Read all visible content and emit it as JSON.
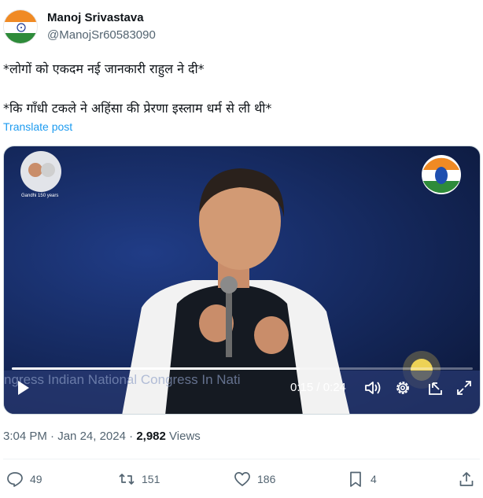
{
  "author": {
    "display_name": "Manoj Srivastava",
    "handle": "@ManojSr60583090"
  },
  "tweet": {
    "line1": "*लोगों को एकदम नई जानकारी राहुल ने दी*",
    "line2": "*कि गाँधी टकले ने अहिंसा की प्रेरणा इस्लाम धर्म से ली थी*",
    "translate_label": "Translate post"
  },
  "video": {
    "time": "0:15 / 0:24",
    "progress_fraction": 0.625,
    "caption_text": "ngress   Indian National Congress   In Nati",
    "badge_text": "Gandhi 150 years"
  },
  "meta": {
    "time": "3:04 PM",
    "date": "Jan 24, 2024",
    "separator": "·",
    "views_count": "2,982",
    "views_label": "Views"
  },
  "actions": {
    "replies": "49",
    "reposts": "151",
    "likes": "186",
    "bookmarks": "4"
  },
  "colors": {
    "accent": "#1d9bf0",
    "secondary_text": "#536471"
  }
}
